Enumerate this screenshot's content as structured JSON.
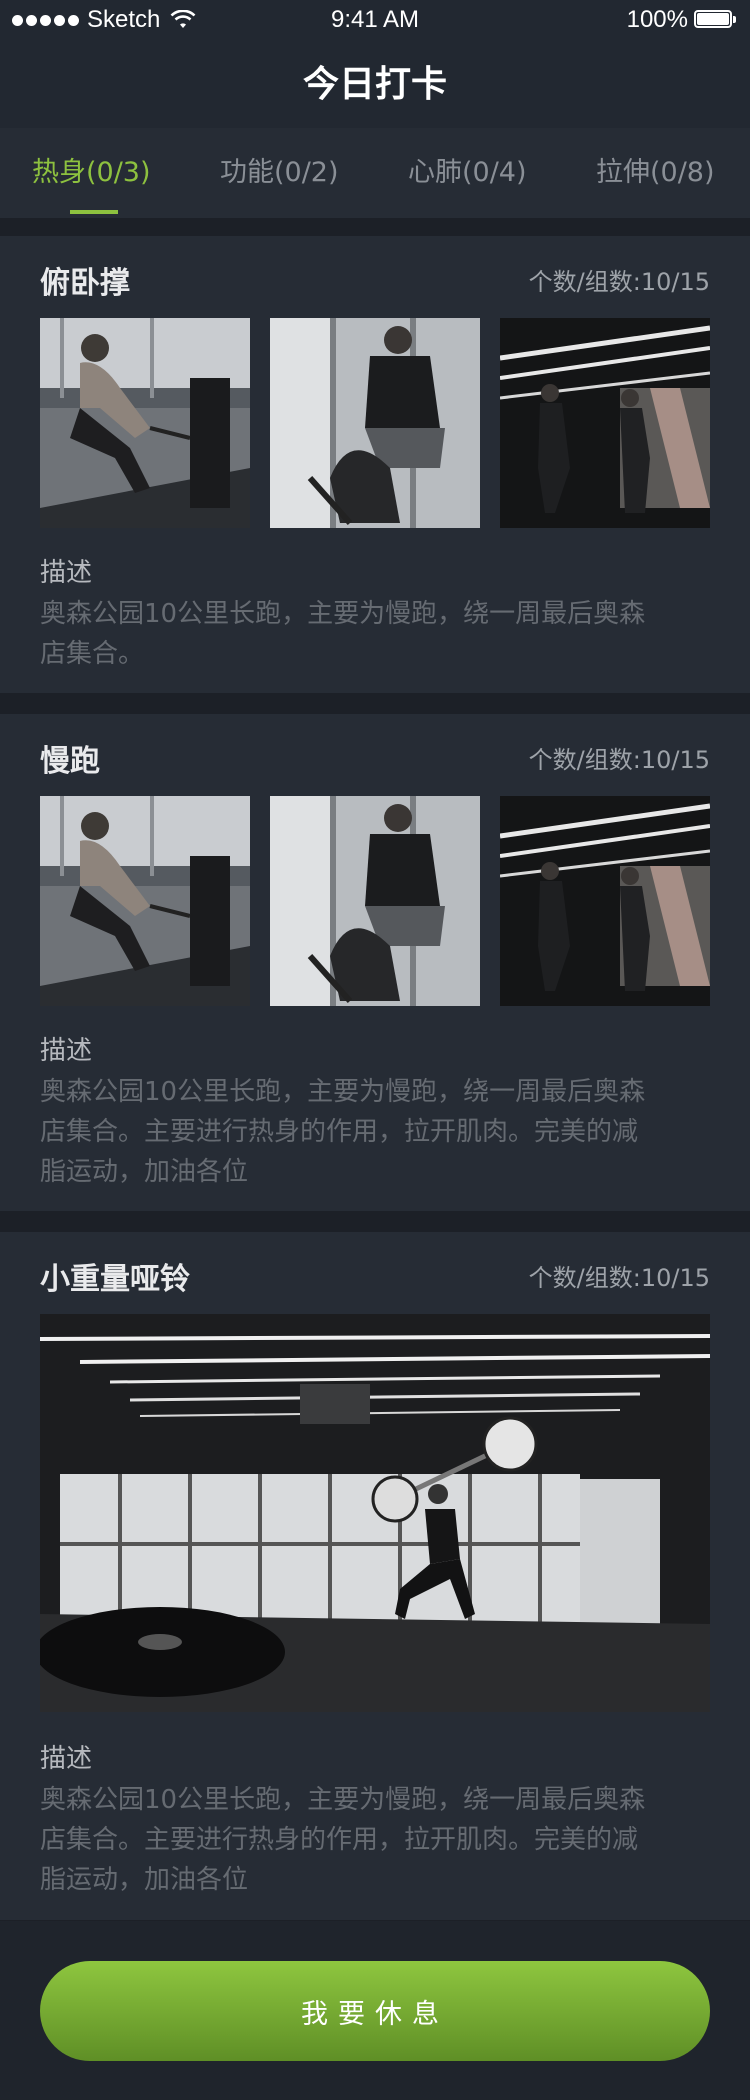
{
  "status_bar": {
    "carrier": "Sketch",
    "time": "9:41 AM",
    "battery": "100%"
  },
  "header": {
    "title": "今日打卡"
  },
  "tabs": [
    {
      "label": "热身(0/3)",
      "active": true
    },
    {
      "label": "功能(0/2)",
      "active": false
    },
    {
      "label": "心肺(0/4)",
      "active": false
    },
    {
      "label": "拉伸(0/8)",
      "active": false
    }
  ],
  "exercises": [
    {
      "name": "俯卧撑",
      "count": "个数/组数:10/15",
      "desc_label": "描述",
      "desc_lines": [
        "奥森公园10公里长跑，主要为慢跑，绕一周最后奥森",
        "店集合。"
      ]
    },
    {
      "name": "慢跑",
      "count": "个数/组数:10/15",
      "desc_label": "描述",
      "desc_lines": [
        "奥森公园10公里长跑，主要为慢跑，绕一周最后奥森",
        "店集合。主要进行热身的作用，拉开肌肉。完美的减",
        "脂运动，加油各位"
      ]
    },
    {
      "name": "小重量哑铃",
      "count": "个数/组数:10/15",
      "desc_label": "描述",
      "desc_lines": [
        "奥森公园10公里长跑，主要为慢跑，绕一周最后奥森",
        "店集合。主要进行热身的作用，拉开肌肉。完美的减",
        "脂运动，加油各位"
      ]
    }
  ],
  "footer": {
    "rest_button": "我要休息"
  },
  "colors": {
    "accent": "#8dc13f",
    "background": "#1c2027",
    "card": "#262c35"
  }
}
